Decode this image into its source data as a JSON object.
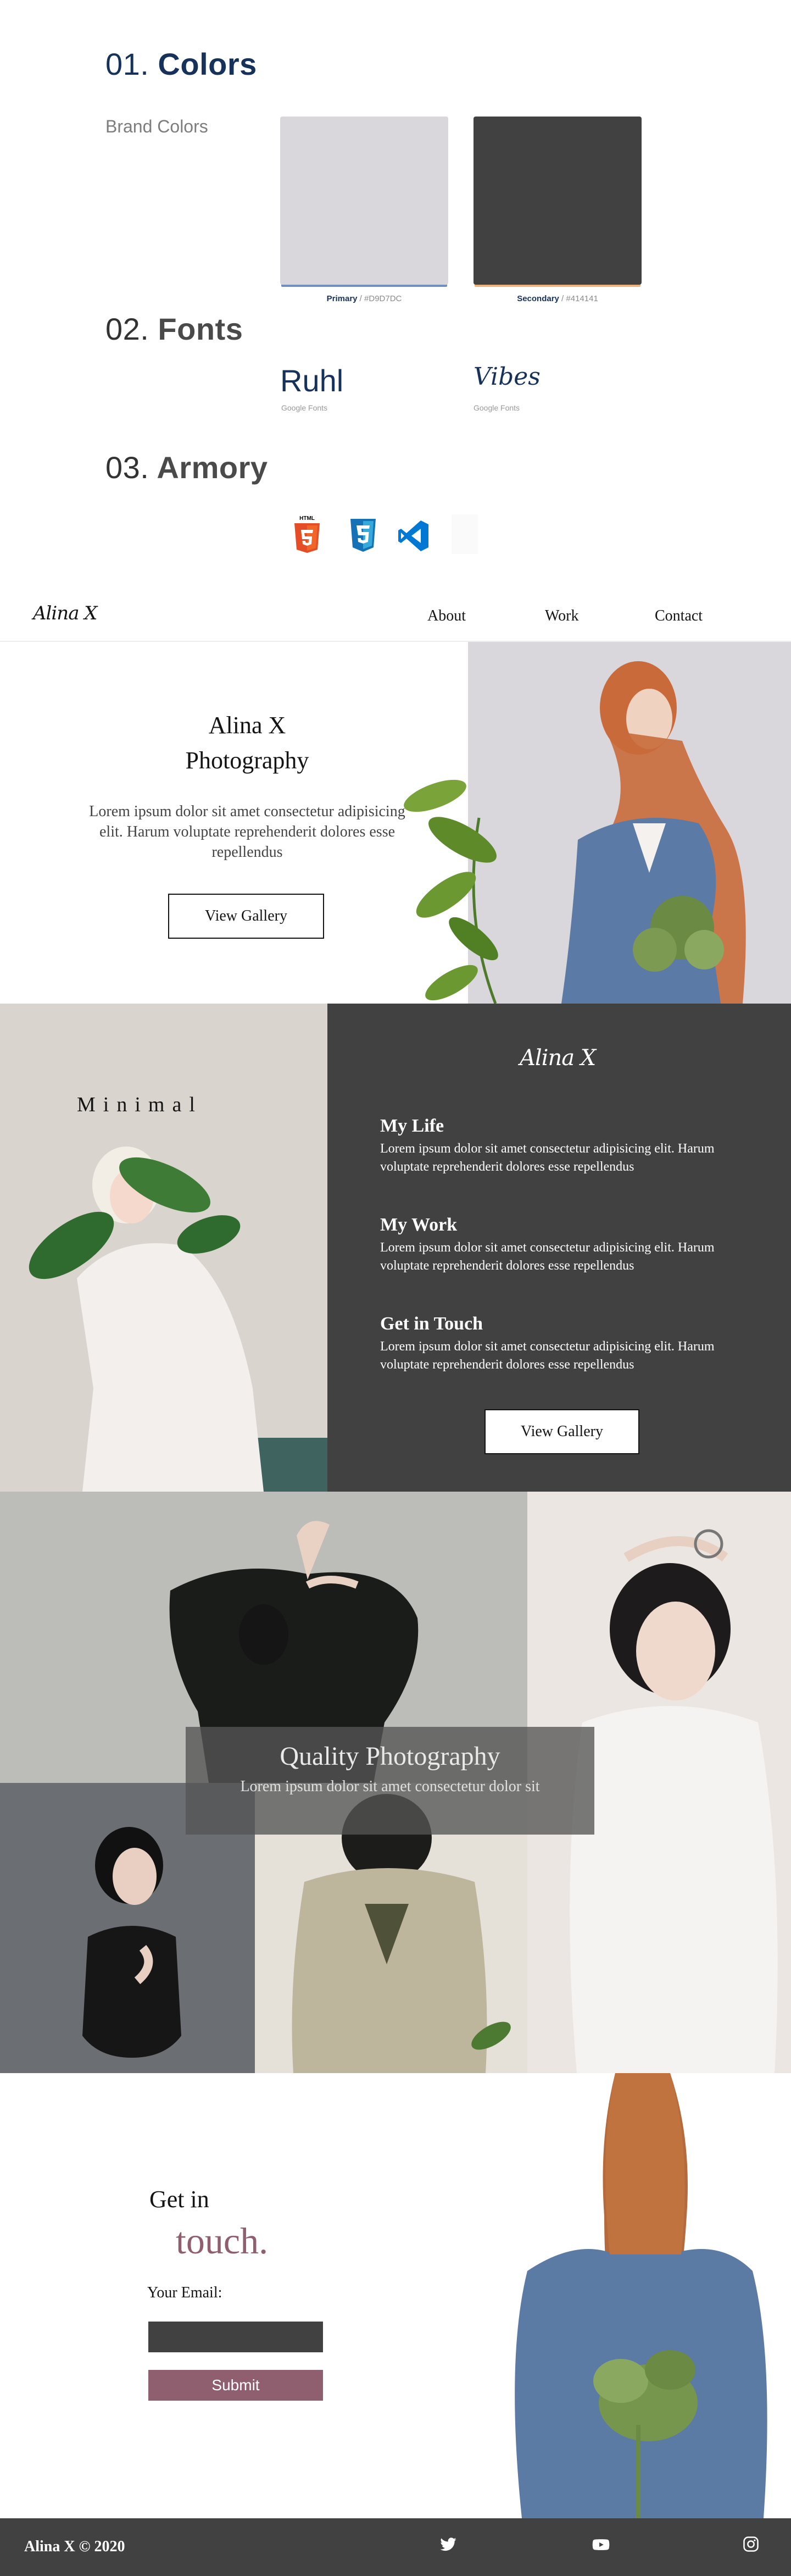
{
  "styleguide": {
    "colors": {
      "num": "01.",
      "title": "Colors",
      "subtitle": "Brand Colors"
    },
    "primary": {
      "label": "Primary",
      "hex": "#D9D7DC"
    },
    "secondary": {
      "label": "Secondary",
      "hex": "#414141"
    },
    "fonts": {
      "num": "02.",
      "title": "Fonts",
      "sample1": "Ruhl",
      "sample2": "Vibes",
      "source": "Google Fonts"
    },
    "armory": {
      "num": "03.",
      "title": "Armory"
    },
    "tool_icons": [
      "html5-icon",
      "css3-icon",
      "vscode-icon"
    ]
  },
  "nav": {
    "logo": "Alina X",
    "links": [
      "About",
      "Work",
      "Contact"
    ]
  },
  "hero": {
    "title_line1": "Alina X",
    "title_line2": "Photography",
    "body": "Lorem ipsum dolor sit amet consectetur adipisicing elit. Harum voluptate reprehenderit dolores esse repellendus",
    "button": "View Gallery"
  },
  "about": {
    "minimal_label": "Minimal",
    "logo": "Alina X",
    "items": [
      {
        "title": "My Life",
        "text": "Lorem ipsum dolor sit amet consectetur adipisicing elit. Harum voluptate reprehenderit dolores esse repellendus"
      },
      {
        "title": "My Work",
        "text": "Lorem ipsum dolor sit amet consectetur adipisicing elit. Harum voluptate reprehenderit dolores esse repellendus"
      },
      {
        "title": "Get in Touch",
        "text": "Lorem ipsum dolor sit amet consectetur adipisicing elit. Harum voluptate reprehenderit dolores esse repellendus"
      }
    ],
    "button": "View Gallery"
  },
  "gallery": {
    "title": "Quality Photography",
    "text": "Lorem ipsum dolor sit amet consectetur dolor sit"
  },
  "contact": {
    "line1": "Get in",
    "line2": "touch.",
    "email_label": "Your Email:",
    "email_value": "",
    "submit": "Submit",
    "accent": "#8f5f70"
  },
  "footer": {
    "copyright": "Alina X © 2020",
    "icons": [
      "twitter-icon",
      "youtube-icon",
      "instagram-icon"
    ]
  }
}
